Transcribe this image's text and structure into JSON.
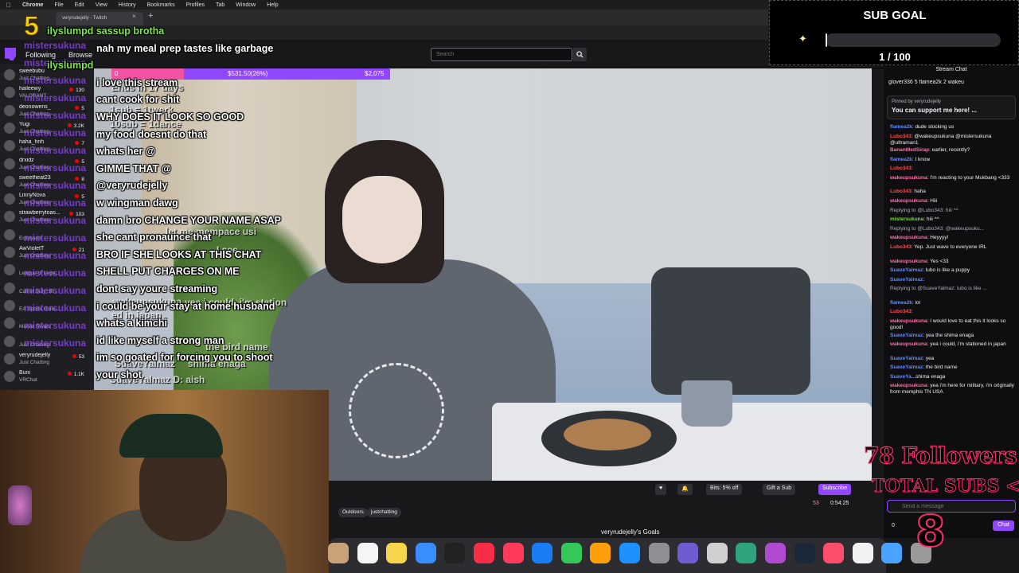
{
  "menubar": {
    "items": [
      "Chrome",
      "File",
      "Edit",
      "View",
      "History",
      "Bookmarks",
      "Profiles",
      "Tab",
      "Window",
      "Help"
    ]
  },
  "browser": {
    "tab_title": "veryrudejelly - Twitch"
  },
  "nav": {
    "following": "Following",
    "browse": "Browse",
    "search_placeholder": "Search"
  },
  "sidebar": {
    "channels": [
      {
        "name": "sweebubu",
        "game": "Just Chatting",
        "viewers": ""
      },
      {
        "name": "haileewy",
        "game": "VALORANT",
        "viewers": "130"
      },
      {
        "name": "deonowens_",
        "game": "Just Chatting",
        "viewers": "5"
      },
      {
        "name": "Yugi",
        "game": "Just Chatting",
        "viewers": "3.2K"
      },
      {
        "name": "haha_hnh",
        "game": "Just Chatting",
        "viewers": "7"
      },
      {
        "name": "drxidz",
        "game": "Just Chatting",
        "viewers": "5"
      },
      {
        "name": "sweetheat23",
        "game": "Just Chatting",
        "viewers": "8"
      },
      {
        "name": "LinnyNova",
        "game": "Just Chatting",
        "viewers": "5"
      },
      {
        "name": "strawberrytoas...",
        "game": "Just Chatting",
        "viewers": "103"
      },
      {
        "name": "",
        "game": "Eclipsium",
        "viewers": ""
      },
      {
        "name": "AwVioletT",
        "game": "Just Chatting",
        "viewers": "21"
      },
      {
        "name": "",
        "game": "League of Lege...",
        "viewers": ""
      },
      {
        "name": "",
        "game": "Call of Duty: Bl...",
        "viewers": ""
      },
      {
        "name": "",
        "game": "EA Sports Colle...",
        "viewers": ""
      },
      {
        "name": "",
        "game": "Marvel Rivals",
        "viewers": ""
      },
      {
        "name": "",
        "game": "Just Chatting",
        "viewers": ""
      },
      {
        "name": "veryrudejelly",
        "game": "Just Chatting",
        "viewers": "53"
      },
      {
        "name": "Buni",
        "game": "VRChat",
        "viewers": "1.1K"
      }
    ]
  },
  "overlay_chat": {
    "lines": [
      "ilyslumpd sassup brotha",
      "nah my meal prep tastes like garbage",
      "ilyslumpd",
      "i love this stream",
      "cant cook for shit",
      "WHY DOES IT LOOK SO GOOD",
      "my food doesnt do that",
      "whats her @",
      "GIMME THAT @",
      "@veryrudejelly",
      "w wingman dawg",
      "damn bro CHANGE YOUR NAME ASAP",
      "she cant pronaunce that",
      "BRO IF SHE LOOKS AT THIS CHAT",
      "SHELL PUT CHARGES ON ME",
      "dont say youre streaming",
      "i could be your stay at home husband",
      "whats a kimchi",
      "id like myself a strong man",
      "im so goated for forcing you to shoot",
      "your shot"
    ],
    "ghost_lines": [
      "Ends in 17 days",
      "1sub = 1twerk",
      "10sub = 1dance",
      "let me mempace usi",
      "I see",
      "yea i could, i'm station",
      "ed in japan",
      "the bird name",
      "shima enaga",
      "SuaveYalmaz D: aish",
      "SuaveYalmaz",
      "wakeupsukuna"
    ],
    "sidebar_ghost": "mistersukuna"
  },
  "badge_number": "5",
  "sub_progress": {
    "start": "0",
    "current": "$531.50(26%)",
    "goal": "$2,075",
    "percent": 26
  },
  "sub_goal": {
    "title": "SUB GOAL",
    "count": "1 / 100",
    "fraction": 0.01
  },
  "controls": {
    "bits_label": "Bits: 5% off",
    "gift_label": "Gift a Sub",
    "subscribe_label": "Subscribe",
    "viewers": "53",
    "uptime": "0:54:25",
    "tags": [
      "Outdoors",
      "justchatting"
    ],
    "goals_label": "veryrudejelly's Goals"
  },
  "chat": {
    "header": "Stream Chat",
    "leaderboard": "glover336 5   flamea2k 2   wakeu",
    "pinned_by": "Pinned by veryrudejelly",
    "pinned_msg": "You can support me here! ...",
    "messages": [
      {
        "user": "flamea2k",
        "text": ": dude stocking us",
        "color": "#5f8cff"
      },
      {
        "user": "Lubo343",
        "text": ": @wakeupsukuna @mistersukuna @ultraman1",
        "color": "#ff4b4b"
      },
      {
        "user": "BananMedSirap",
        "text": ": earlier, recently?",
        "color": "#ff6fa6"
      },
      {
        "user": "flamea2k",
        "text": ": I know",
        "color": "#5f8cff"
      },
      {
        "user": "Lubo343",
        "text": ":",
        "color": "#ff4b4b"
      },
      {
        "user": "wakeupsukuna",
        "text": ": I'm reacting to your Mukbang <333",
        "color": "#ff6fa6"
      },
      {
        "user": "Lubo343",
        "text": ": haha",
        "color": "#ff4b4b"
      },
      {
        "user": "wakeupsukuna",
        "text": ": Hiii",
        "color": "#ff6fa6"
      },
      {
        "user": "",
        "text": "Replying to @Lubo343: hiii ^^",
        "color": "#adadb8"
      },
      {
        "user": "mistersukuna",
        "text": ": hiii ^^",
        "color": "#7fd44b"
      },
      {
        "user": "",
        "text": "Replying to @Lubo343: @wakeupsuku...",
        "color": "#adadb8"
      },
      {
        "user": "wakeupsukuna",
        "text": ": Heyyyy!",
        "color": "#ff6fa6"
      },
      {
        "user": "Lubo343",
        "text": ": Yep. Just wave to everyone IRL",
        "color": "#ff4b4b"
      },
      {
        "user": "wakeupsukuna",
        "text": ": Yes <33",
        "color": "#ff6fa6"
      },
      {
        "user": "SuaveYalmaz",
        "text": ": lubo is like a puppy",
        "color": "#5f8cff"
      },
      {
        "user": "SuaveYalmaz",
        "text": ":",
        "color": "#5f8cff"
      },
      {
        "user": "",
        "text": "Replying to @SuaveYalmaz: lubo is like ...",
        "color": "#adadb8"
      },
      {
        "user": "flamea2k",
        "text": ": lol",
        "color": "#5f8cff"
      },
      {
        "user": "Lubo343",
        "text": ":",
        "color": "#ff4b4b"
      },
      {
        "user": "wakeupsukuna",
        "text": ": I would love to eat this it looks so good!",
        "color": "#ff6fa6"
      },
      {
        "user": "SuaveYalmaz",
        "text": ": yea the shima enaga",
        "color": "#5f8cff"
      },
      {
        "user": "wakeupsukuna",
        "text": ": yea i could, i'm stationed in japan",
        "color": "#ff6fa6"
      },
      {
        "user": "SuaveYalmaz",
        "text": ": yea",
        "color": "#5f8cff"
      },
      {
        "user": "SuaveYalmaz",
        "text": ": the bird name",
        "color": "#5f8cff"
      },
      {
        "user": "SuaveYa...",
        "text": "shima enaga",
        "color": "#5f8cff"
      },
      {
        "user": "wakeupsukuna",
        "text": ": yea i'm here for military, i'm originally from memphis TN USA",
        "color": "#ff6fa6"
      }
    ],
    "input_placeholder": "Send a message",
    "points": "0",
    "send_label": "Chat"
  },
  "overlay_stats": {
    "followers": "78 Followers",
    "total_subs_label": "TOTAL SUBS <",
    "subs_count": "8"
  },
  "dock_icons": [
    "contacts-icon",
    "reminders-icon",
    "notes-icon",
    "freeform-icon",
    "appletv-icon",
    "music-icon",
    "news-icon",
    "keynote-icon",
    "numbers-icon",
    "pages-icon",
    "appstore-icon",
    "settings-icon",
    "feedback-icon",
    "iphone-mirror-icon",
    "chatgpt-icon",
    "obs-icon",
    "steam-icon",
    "creativecloud-icon",
    "chrome-icon",
    "finder-icon",
    "trash-icon"
  ]
}
